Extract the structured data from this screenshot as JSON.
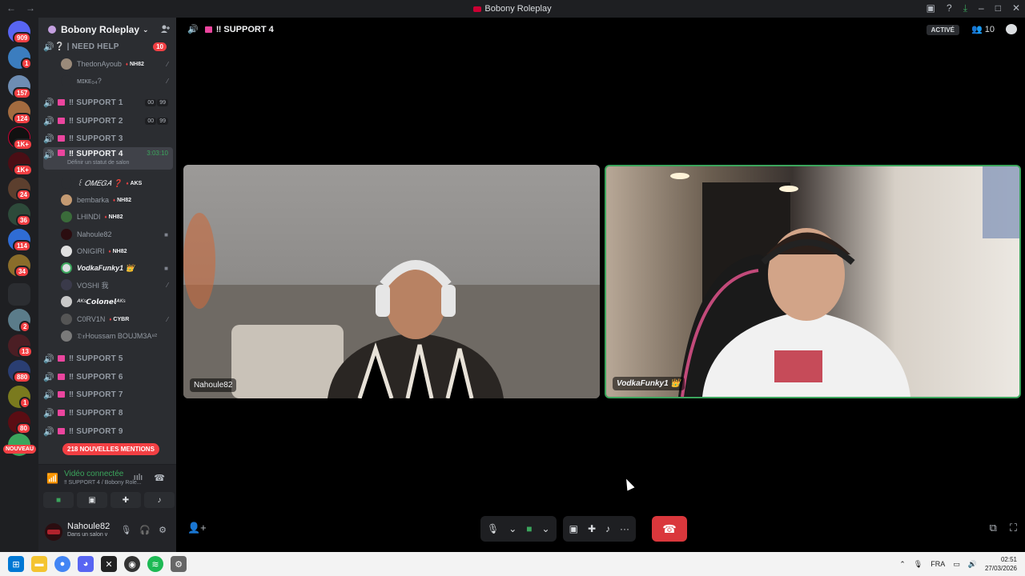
{
  "window": {
    "title": "Bobony Roleplay",
    "back": "←",
    "forward": "→"
  },
  "rail": {
    "servers": [
      {
        "badge": "909"
      },
      {
        "badge": "1"
      },
      {
        "badge": "157"
      },
      {
        "badge": "124"
      },
      {
        "badge": "1K+"
      },
      {
        "badge": "1K+"
      },
      {
        "badge": "24"
      },
      {
        "badge": "36"
      },
      {
        "badge": "114"
      },
      {
        "badge": "34"
      },
      {
        "badge": "2"
      },
      {
        "badge": "13"
      },
      {
        "badge": "880"
      },
      {
        "badge": "1"
      },
      {
        "badge": "80"
      }
    ],
    "new_label": "NOUVEAU"
  },
  "sidebar": {
    "server_name": "Bobony Roleplay",
    "channels": [
      {
        "name": "❔ | NEED HELP",
        "count": "10"
      },
      {
        "name": "‼ SUPPORT 1",
        "pills": [
          "00",
          "99"
        ]
      },
      {
        "name": "‼ SUPPORT 2",
        "pills": [
          "00",
          "99"
        ]
      },
      {
        "name": "‼ SUPPORT 3"
      },
      {
        "name": "‼ SUPPORT 4",
        "timer": "3:03:10",
        "status": "Définir un statut de salon"
      },
      {
        "name": "‼ SUPPORT 5"
      },
      {
        "name": "‼ SUPPORT 6"
      },
      {
        "name": "‼ SUPPORT 7"
      },
      {
        "name": "‼ SUPPORT 8"
      },
      {
        "name": "‼ SUPPORT 9"
      }
    ],
    "help_users": [
      {
        "name": "ThedonAyoub",
        "tag": "NH82"
      },
      {
        "name": "ᴍɪᴋᴇ₀₄?"
      }
    ],
    "support4_users": [
      {
        "name": "꒰ 𝑂𝑀𝐸𝐺𝐴 ❓",
        "tag": "AKS"
      },
      {
        "name": "bembarka",
        "tag": "NH82"
      },
      {
        "name": "LHINDI",
        "tag": "NH82"
      },
      {
        "name": "Nahoule82"
      },
      {
        "name": "ONIGIRI",
        "tag": "NH82"
      },
      {
        "name": "VodkaFunky1 👑"
      },
      {
        "name": "VOSHI 我"
      },
      {
        "name": "ᴬᴷˢ𝘾𝙤𝙡𝙤𝙣𝙚𝙡ᴬᴷˢ"
      },
      {
        "name": "C0RV1N",
        "tag": "CYBR"
      },
      {
        "name": "𝔇𝔵Houssam BOUJM3A⁸²"
      }
    ],
    "mentions": "218 NOUVELLES MENTIONS"
  },
  "voice": {
    "status": "Vidéo connectée",
    "location": "‼ SUPPORT 4 / Bobony Role..."
  },
  "user": {
    "name": "Nahoule82",
    "status": "Dans un salon v"
  },
  "main": {
    "channel": "‼ SUPPORT 4",
    "active_label": "ACTIVÉ",
    "participants": "10",
    "tiles": [
      {
        "name": "Nahoule82"
      },
      {
        "name": "VodkaFunky1 👑"
      }
    ]
  },
  "taskbar": {
    "lang": "FRA",
    "time": "02:51",
    "date": "27/03/2026"
  },
  "colors": {
    "accent_green": "#3ba55c",
    "danger_red": "#da373c",
    "channel_pink": "#eb459e"
  }
}
